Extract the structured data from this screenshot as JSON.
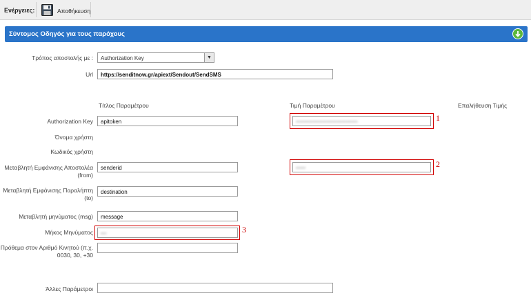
{
  "toolbar": {
    "label": "Ενέργειες:",
    "save_label": "Αποθήκευση",
    "save_icon": "floppy-disk-icon"
  },
  "banner": {
    "title": "Σύντομος Οδηγός για τους παρόχους",
    "icon": "download-arrow-icon",
    "color": "#2a74c9"
  },
  "send_method": {
    "label": "Τρόπος αποστολής με :",
    "value": "Authorization Key"
  },
  "url": {
    "label": "Url",
    "value": "https://senditnow.gr/apiext/Sendout/SendSMS"
  },
  "columns": {
    "title": "Τίτλος Παραμέτρου",
    "value": "Τιμή Παραμέτρου",
    "confirm": "Επαλήθευση Τιμής"
  },
  "rows": {
    "auth_key": {
      "label": "Authorization Key",
      "title": "apitoken",
      "value": "••••••••••••••••••••••••••••••••"
    },
    "username": {
      "label": "Όνομα χρήστη"
    },
    "password": {
      "label": "Κωδικός χρήστη"
    },
    "sender": {
      "label": "Μεταβλητή Εμφάνισης Αποστολέα (from)",
      "title": "senderid",
      "value": "•••••"
    },
    "recipient": {
      "label": "Μεταβλητή Εμφάνισης Παραλήπτη (to)",
      "title": "destination"
    },
    "message": {
      "label": "Μεταβλητή μηνύματος (msg)",
      "title": "message"
    },
    "length": {
      "label": "Μήκος Μηνύματος",
      "title": "•••"
    },
    "prefix": {
      "label": "Πρόθεμα στον Αριθμό Κινητού (π.χ. 0030, 30, +30",
      "title": ""
    },
    "other": {
      "label": "Άλλες Παράμετροι",
      "title": ""
    }
  },
  "annotations": [
    "1",
    "2",
    "3"
  ],
  "highlight_color": "#d10000"
}
